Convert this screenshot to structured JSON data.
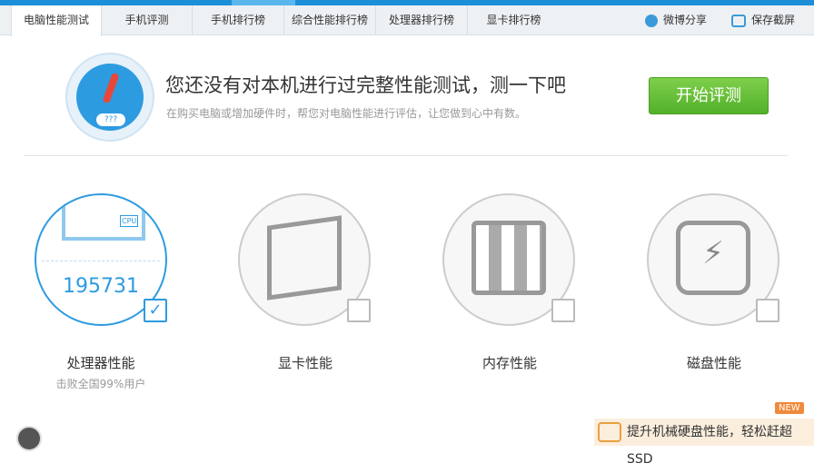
{
  "tabs": [
    "电脑性能测试",
    "手机评测",
    "手机排行榜",
    "综合性能排行榜",
    "处理器排行榜",
    "显卡排行榜"
  ],
  "actions": {
    "weibo": "微博分享",
    "screenshot": "保存截屏"
  },
  "banner": {
    "gauge_text": "???",
    "title": "您还没有对本机进行过完整性能测试，测一下吧",
    "subtitle": "在购买电脑或增加硬件时，帮您对电脑性能进行评估，让您做到心中有数。",
    "start": "开始评测"
  },
  "cards": [
    {
      "label": "处理器性能",
      "score": "195731",
      "beat": "击败全国99%用户",
      "checked": true,
      "chip": "CPU"
    },
    {
      "label": "显卡性能",
      "checked": false
    },
    {
      "label": "内存性能",
      "checked": false
    },
    {
      "label": "磁盘性能",
      "checked": false
    }
  ],
  "promo": {
    "badge": "NEW",
    "text": "提升机械硬盘性能，轻松赶超SSD"
  },
  "colors": {
    "accent": "#2d9be0",
    "start": "#5bb531",
    "promo": "#f08a3c"
  }
}
